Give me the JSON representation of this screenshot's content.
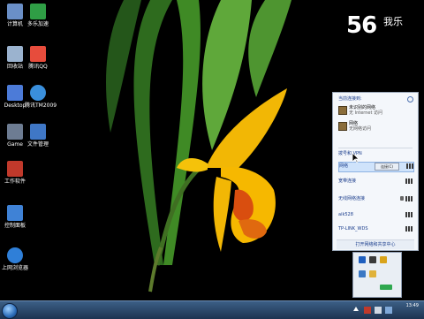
{
  "watermark": {
    "number": "56",
    "brand": "我乐"
  },
  "desktop_icons": [
    {
      "label": "计算机",
      "color": "#6a8fc7"
    },
    {
      "label": "回收站",
      "color": "#9bb3cf"
    },
    {
      "label": "Desktop",
      "color": "#4c7bd8"
    },
    {
      "label": "Game",
      "color": "#6d7c92"
    },
    {
      "label": "工作软件",
      "color": "#c0392b"
    },
    {
      "label": "控制面板",
      "color": "#3f82d6"
    },
    {
      "label": "上网浏览器",
      "color": "#2f7fd8"
    },
    {
      "label": "多乐加速",
      "color": "#2f9e45"
    },
    {
      "label": "腾讯QQ",
      "color": "#e74c3c"
    },
    {
      "label": "腾讯TM2009",
      "color": "#3a8fdc"
    },
    {
      "label": "文件管理",
      "color": "#3f77c6"
    }
  ],
  "network_popup": {
    "title": "当前连接到:",
    "connections": [
      {
        "name": "未识别的网络",
        "status": "无 Internet 访问"
      },
      {
        "name": "网络",
        "status": "无网络访问"
      }
    ],
    "dialup_section": "拨号和 VPN",
    "wifi_networks": [
      {
        "name": "网络",
        "button": "连接(C)",
        "selected": true
      },
      {
        "name": "宽带连接",
        "selected": false
      },
      {
        "name": "无线网络连接",
        "selected": false
      },
      {
        "name": "aik528",
        "selected": false
      },
      {
        "name": "TP-LINK_WDS",
        "selected": false
      }
    ],
    "footer": "打开网络和共享中心"
  },
  "tray": {
    "time": "13:49",
    "date": ""
  },
  "colors": {
    "taskbar": "#2b476b",
    "popup_bg": "#f4f7fb",
    "link": "#1a3d8c",
    "selected": "#cfe3fb"
  }
}
